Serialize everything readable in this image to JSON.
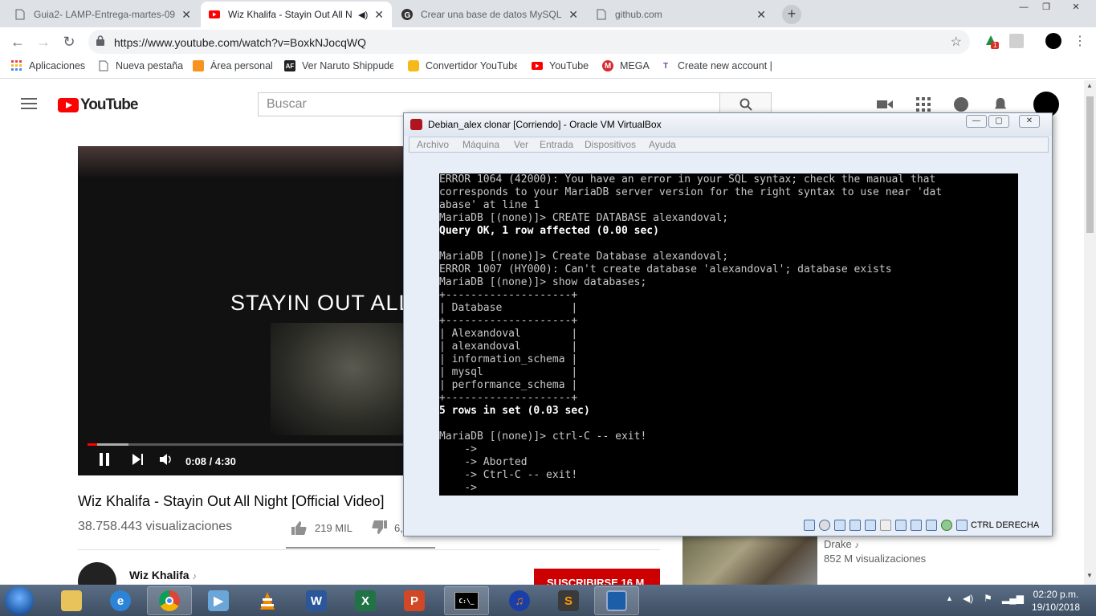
{
  "browser": {
    "tabs": [
      {
        "title": "Guia2- LAMP-Entrega-martes-09",
        "close": "✕"
      },
      {
        "title": "Wiz Khalifa - Stayin Out All N",
        "close": "✕"
      },
      {
        "title": "Crear una base de datos MySQL",
        "close": "✕"
      },
      {
        "title": "github.com",
        "close": "✕"
      }
    ],
    "new_tab": "+",
    "url": "https://www.youtube.com/watch?v=BoxkNJocqWQ",
    "extension_badge": "1",
    "bookmarks": [
      {
        "label": "Aplicaciones"
      },
      {
        "label": "Nueva pestaña"
      },
      {
        "label": "Área personal"
      },
      {
        "label": "Ver Naruto Shippude"
      },
      {
        "label": "Convertidor YouTube"
      },
      {
        "label": "YouTube"
      },
      {
        "label": "MEGA"
      },
      {
        "label": "Create new account |"
      }
    ],
    "bookmark_icon_letters": {
      "af": "AF",
      "mega": "M",
      "t": "T"
    }
  },
  "youtube": {
    "logo_text": "YouTube",
    "search_placeholder": "Buscar",
    "video_overlay_text": "STAYIN OUT ALL",
    "time": "0:08 / 4:30",
    "progress_fraction": 0.0296,
    "title": "Wiz Khalifa - Stayin Out All Night [Official Video]",
    "views": "38.758.443 visualizaciones",
    "likes": "219 MIL",
    "dislikes": "6,",
    "channel": "Wiz Khalifa",
    "subscribe": "SUSCRIBIRSE 16 M",
    "related": {
      "channel": "Drake",
      "views": "852 M visualizaciones"
    }
  },
  "vbox": {
    "title": "Debian_alex clonar [Corriendo] - Oracle VM VirtualBox",
    "menu": [
      "Archivo",
      "Máquina",
      "Ver",
      "Entrada",
      "Dispositivos",
      "Ayuda"
    ],
    "host_key": "CTRL DERECHA",
    "console_lines": [
      {
        "text": "ERROR 1064 (42000): You have an error in your SQL syntax; check the manual that",
        "hl": false
      },
      {
        "text": "corresponds to your MariaDB server version for the right syntax to use near 'dat",
        "hl": false
      },
      {
        "text": "abase' at line 1",
        "hl": false
      },
      {
        "text": "MariaDB [(none)]> CREATE DATABASE alexandoval;",
        "hl": false
      },
      {
        "text": "Query OK, 1 row affected (0.00 sec)",
        "hl": true
      },
      {
        "text": "",
        "hl": false
      },
      {
        "text": "MariaDB [(none)]> Create Database alexandoval;",
        "hl": false
      },
      {
        "text": "ERROR 1007 (HY000): Can't create database 'alexandoval'; database exists",
        "hl": false
      },
      {
        "text": "MariaDB [(none)]> show databases;",
        "hl": false
      },
      {
        "text": "+--------------------+",
        "hl": false
      },
      {
        "text": "| Database           |",
        "hl": false
      },
      {
        "text": "+--------------------+",
        "hl": false
      },
      {
        "text": "| Alexandoval        |",
        "hl": false
      },
      {
        "text": "| alexandoval        |",
        "hl": false
      },
      {
        "text": "| information_schema |",
        "hl": false
      },
      {
        "text": "| mysql              |",
        "hl": false
      },
      {
        "text": "| performance_schema |",
        "hl": false
      },
      {
        "text": "+--------------------+",
        "hl": false
      },
      {
        "text": "5 rows in set (0.03 sec)",
        "hl": true
      },
      {
        "text": "",
        "hl": false
      },
      {
        "text": "MariaDB [(none)]> ctrl-C -- exit!",
        "hl": false
      },
      {
        "text": "    ->",
        "hl": false
      },
      {
        "text": "    -> Aborted",
        "hl": false
      },
      {
        "text": "    -> Ctrl-C -- exit!",
        "hl": false
      },
      {
        "text": "    ->",
        "hl": false
      }
    ]
  },
  "taskbar": {
    "cmd_label": "C:\\_",
    "clock_time": "02:20 p.m.",
    "clock_date": "19/10/2018"
  },
  "colors": {
    "youtube_red": "#ff0000",
    "subscribe_red": "#cc0000",
    "vbox_frame": "#e8eef7",
    "taskbar": "#4a5c73"
  },
  "icons": [
    "back-icon",
    "forward-icon",
    "reload-icon",
    "lock-icon",
    "star-icon",
    "search-icon",
    "video-camera-icon",
    "apps-grid-icon",
    "messages-icon",
    "bell-icon",
    "avatar",
    "pause-icon",
    "next-icon",
    "volume-icon",
    "like-icon",
    "dislike-icon"
  ]
}
